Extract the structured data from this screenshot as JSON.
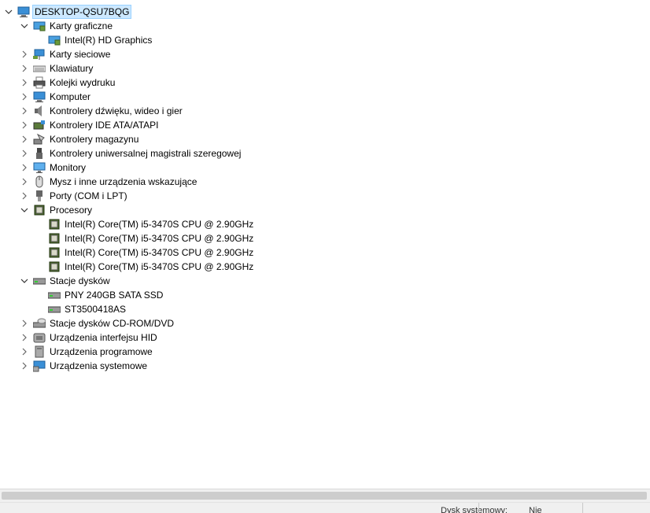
{
  "tree": {
    "root": "DESKTOP-QSU7BQG",
    "items": [
      {
        "label": "Karty graficzne",
        "expanded": true,
        "icon": "display-adapter-icon",
        "children": [
          {
            "label": "Intel(R) HD Graphics",
            "icon": "display-adapter-icon"
          }
        ]
      },
      {
        "label": "Karty sieciowe",
        "expanded": false,
        "icon": "network-adapter-icon"
      },
      {
        "label": "Klawiatury",
        "expanded": false,
        "icon": "keyboard-icon"
      },
      {
        "label": "Kolejki wydruku",
        "expanded": false,
        "icon": "printer-icon"
      },
      {
        "label": "Komputer",
        "expanded": false,
        "icon": "computer-icon"
      },
      {
        "label": "Kontrolery dźwięku, wideo i gier",
        "expanded": false,
        "icon": "speaker-icon"
      },
      {
        "label": "Kontrolery IDE ATA/ATAPI",
        "expanded": false,
        "icon": "ide-controller-icon"
      },
      {
        "label": "Kontrolery magazynu",
        "expanded": false,
        "icon": "storage-controller-icon"
      },
      {
        "label": "Kontrolery uniwersalnej magistrali szeregowej",
        "expanded": false,
        "icon": "usb-icon"
      },
      {
        "label": "Monitory",
        "expanded": false,
        "icon": "monitor-icon"
      },
      {
        "label": "Mysz i inne urządzenia wskazujące",
        "expanded": false,
        "icon": "mouse-icon"
      },
      {
        "label": "Porty (COM i LPT)",
        "expanded": false,
        "icon": "port-icon"
      },
      {
        "label": "Procesory",
        "expanded": true,
        "icon": "processor-icon",
        "children": [
          {
            "label": "Intel(R) Core(TM) i5-3470S CPU @ 2.90GHz",
            "icon": "processor-icon"
          },
          {
            "label": "Intel(R) Core(TM) i5-3470S CPU @ 2.90GHz",
            "icon": "processor-icon"
          },
          {
            "label": "Intel(R) Core(TM) i5-3470S CPU @ 2.90GHz",
            "icon": "processor-icon"
          },
          {
            "label": "Intel(R) Core(TM) i5-3470S CPU @ 2.90GHz",
            "icon": "processor-icon"
          }
        ]
      },
      {
        "label": "Stacje dysków",
        "expanded": true,
        "icon": "disk-drive-icon",
        "children": [
          {
            "label": "PNY 240GB SATA SSD",
            "icon": "disk-drive-icon"
          },
          {
            "label": "ST3500418AS",
            "icon": "disk-drive-icon"
          }
        ]
      },
      {
        "label": "Stacje dysków CD-ROM/DVD",
        "expanded": false,
        "icon": "cdrom-icon"
      },
      {
        "label": "Urządzenia interfejsu HID",
        "expanded": false,
        "icon": "hid-icon"
      },
      {
        "label": "Urządzenia programowe",
        "expanded": false,
        "icon": "software-device-icon"
      },
      {
        "label": "Urządzenia systemowe",
        "expanded": false,
        "icon": "system-device-icon"
      }
    ]
  },
  "status": {
    "left": "Dysk systemowy:",
    "right": "Nie"
  }
}
